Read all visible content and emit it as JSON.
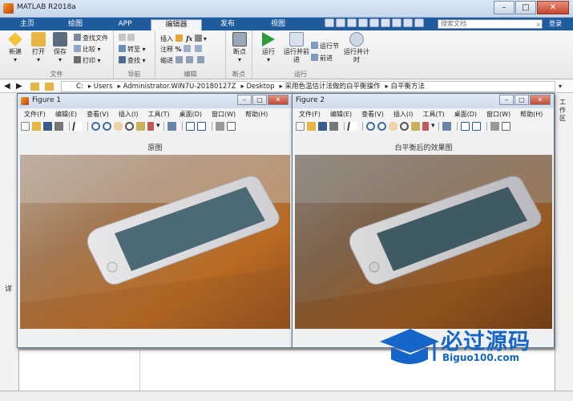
{
  "window": {
    "title": "MATLAB R2018a"
  },
  "tabs": [
    "主页",
    "绘图",
    "APP",
    "编辑器",
    "发布",
    "视图"
  ],
  "search": {
    "placeholder": "搜索文档",
    "signin": "登录"
  },
  "ribbon": {
    "groups": [
      "文件",
      "导航",
      "编辑",
      "断点",
      "运行"
    ],
    "file": {
      "new": "新建",
      "open": "打开",
      "save": "保存",
      "find_files": "查找文件",
      "compare": "比较",
      "print": "打印"
    },
    "nav": {
      "goto": "转至",
      "find": "查找"
    },
    "edit": {
      "insert": "插入",
      "comment": "注释",
      "indent": "缩进",
      "fx": "fx"
    },
    "breakpoints": {
      "label": "断点"
    },
    "run": {
      "run": "运行",
      "run_advance": "运行并前进",
      "run_section": "运行节",
      "advance": "前进",
      "run_time": "运行并计时"
    }
  },
  "address": {
    "segments": [
      "C:",
      "Users",
      "Administrator.WIN7U-20180127Z",
      "Desktop",
      "采用色温估计法做的白平衡操作",
      "白平衡方法"
    ]
  },
  "left_panel": {
    "label": "详"
  },
  "right_panel": {
    "label": "工作区"
  },
  "figures": [
    {
      "title": "Figure 1",
      "menu": [
        "文件(F)",
        "编辑(E)",
        "查看(V)",
        "插入(I)",
        "工具(T)",
        "桌面(D)",
        "窗口(W)",
        "帮助(H)"
      ],
      "plot_title": "原图",
      "image": "photo of white smartphone on wooden table"
    },
    {
      "title": "Figure 2",
      "menu": [
        "文件(F)",
        "编辑(E)",
        "查看(V)",
        "插入(I)",
        "工具(T)",
        "桌面(D)",
        "窗口(W)",
        "帮助(H)"
      ],
      "plot_title": "白平衡后的效果图",
      "image": "white-balanced photo of white smartphone on table"
    }
  ],
  "watermark": {
    "cn": "必过源码",
    "en": "Biguo100.com"
  },
  "colors": {
    "tabbar": "#1e5c9e",
    "brand": "#1566c8",
    "run": "#2e9b3a"
  }
}
